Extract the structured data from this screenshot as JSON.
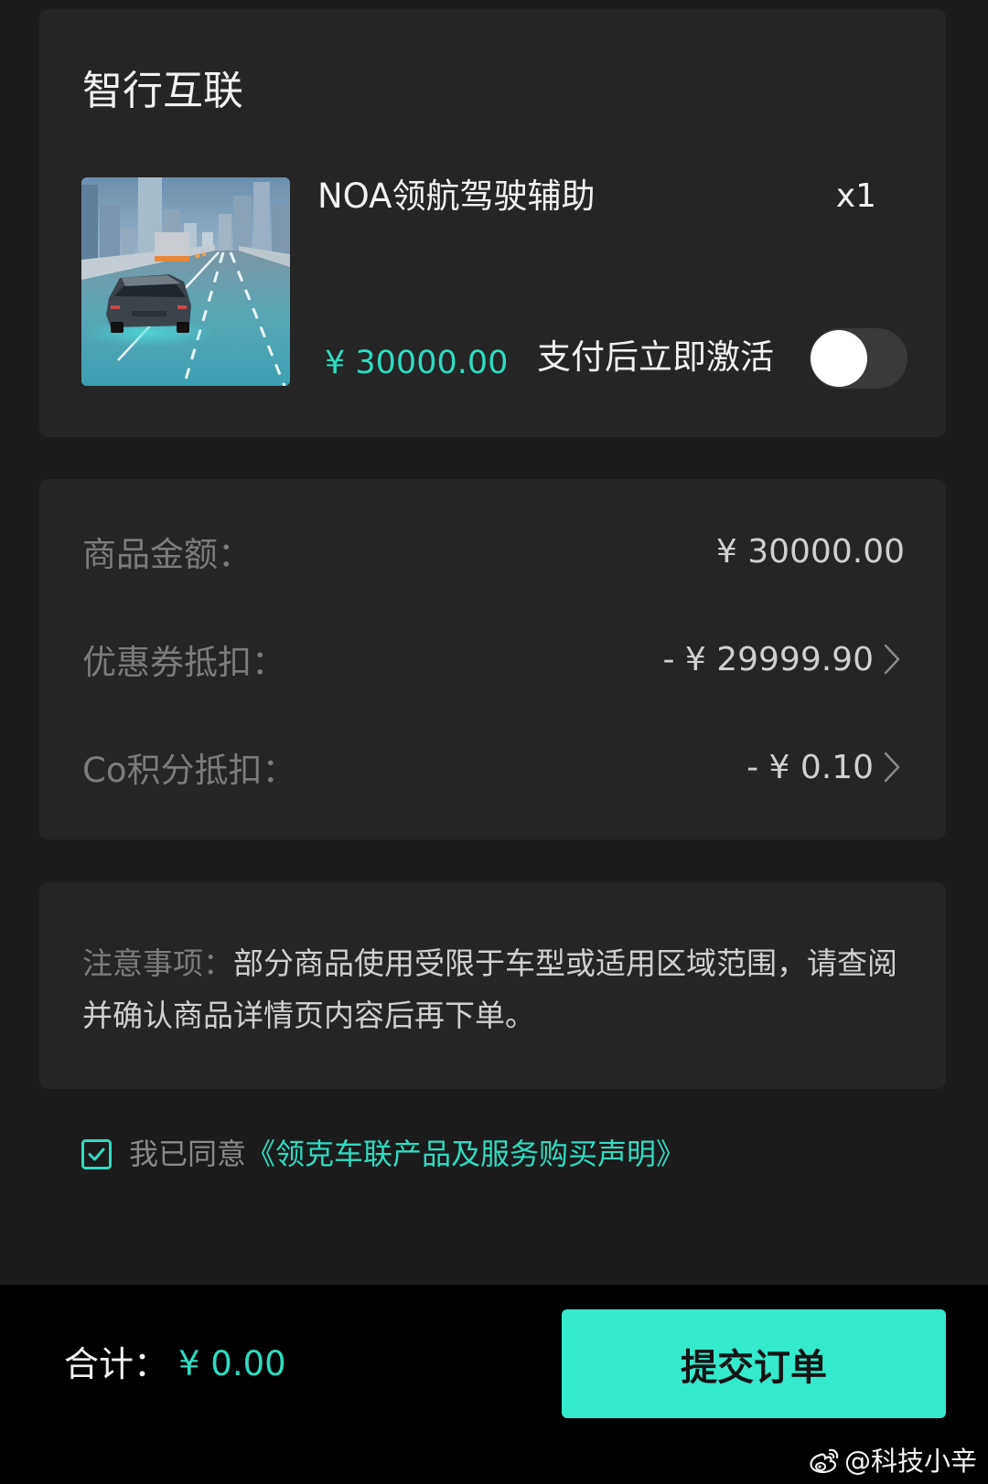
{
  "section_title": "智行互联",
  "product": {
    "name": "NOA领航驾驶辅助",
    "quantity": "x1",
    "price": "¥ 30000.00",
    "activate_label": "支付后立即激活",
    "activate_on": false
  },
  "summary": {
    "rows": [
      {
        "label": "商品金额：",
        "value": "¥ 30000.00",
        "has_chevron": false
      },
      {
        "label": "优惠券抵扣：",
        "value": "- ¥ 29999.90",
        "has_chevron": true
      },
      {
        "label": "Co积分抵扣：",
        "value": "- ¥ 0.10",
        "has_chevron": true
      }
    ]
  },
  "notice": {
    "label": "注意事项：",
    "text": "部分商品使用受限于车型或适用区域范围，请查阅并确认商品详情页内容后再下单。"
  },
  "agreement": {
    "checked": true,
    "prefix": "我已同意",
    "link": "《领克车联产品及服务购买声明》"
  },
  "footer": {
    "total_label": "合计：",
    "total_value": "¥ 0.00",
    "submit_label": "提交订单"
  },
  "watermark": {
    "text": "@科技小辛"
  },
  "icons": {
    "product_image": "road-car-illustration",
    "summary_chevron": "chevron-right-icon",
    "agreement_checkbox": "checkbox-checked-icon",
    "watermark_logo": "weibo-icon"
  },
  "colors": {
    "background": "#1b1b1b",
    "card": "#252525",
    "bottom_bar": "#000000",
    "accent": "#2fdcc0",
    "button": "#35e9cb",
    "toggle_track": "#3a3a3a",
    "label_gray": "#7c7c7c",
    "value_gray": "#d0d0d0"
  }
}
